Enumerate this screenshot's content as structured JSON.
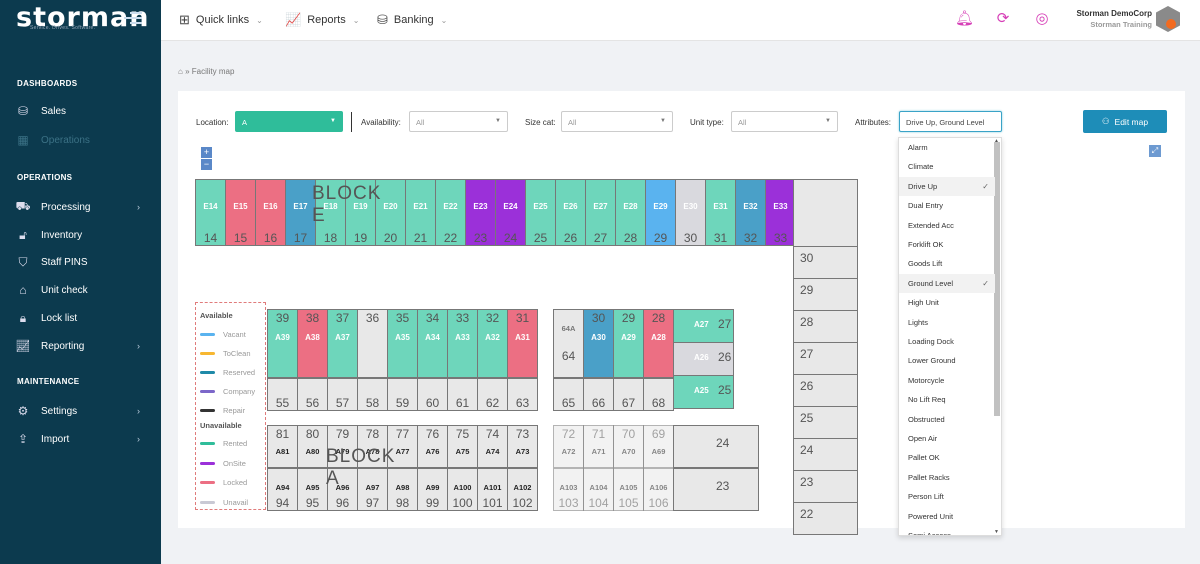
{
  "brand": {
    "name": "storman",
    "tagline": "Service. Drives. Software."
  },
  "sidebar": {
    "sections": [
      {
        "title": "DASHBOARDS",
        "items": [
          {
            "label": "Sales",
            "icon": "piggy-bank-icon"
          },
          {
            "label": "Operations",
            "icon": "building-icon",
            "dim": true
          }
        ]
      },
      {
        "title": "OPERATIONS",
        "items": [
          {
            "label": "Processing",
            "icon": "truck-icon",
            "arrow": true
          },
          {
            "label": "Inventory",
            "icon": "lock-open-icon"
          },
          {
            "label": "Staff PINS",
            "icon": "shield-icon"
          },
          {
            "label": "Unit check",
            "icon": "garage-icon"
          },
          {
            "label": "Lock list",
            "icon": "lock-icon"
          },
          {
            "label": "Reporting",
            "icon": "chart-icon",
            "arrow": true
          }
        ]
      },
      {
        "title": "MAINTENANCE",
        "items": [
          {
            "label": "Settings",
            "icon": "gear-icon",
            "arrow": true
          },
          {
            "label": "Import",
            "icon": "import-icon",
            "arrow": true
          }
        ]
      }
    ]
  },
  "topbar": {
    "menus": [
      {
        "label": "Quick links",
        "icon": "plus-box-icon"
      },
      {
        "label": "Reports",
        "icon": "chart-icon"
      },
      {
        "label": "Banking",
        "icon": "piggy-bank-icon"
      }
    ],
    "user": {
      "company": "Storman DemoCorp",
      "site": "Storman Training"
    }
  },
  "breadcrumb": "» Facility map",
  "filters": {
    "location_label": "Location:",
    "location_value": "A",
    "availability_label": "Availability:",
    "availability_value": "All",
    "size_label": "Size cat:",
    "size_value": "All",
    "unit_type_label": "Unit type:",
    "unit_type_value": "All",
    "attributes_label": "Attributes:",
    "attributes_value": "Drive Up, Ground Level",
    "edit_map": "Edit map"
  },
  "colors": {
    "rented": "#6ed6bb",
    "onsite": "#9b30d9",
    "locked": "#ec6f83",
    "reserved": "#4aa0c8",
    "vacant": "#5ab3ef",
    "unavail": "#d9d9de",
    "empty": "#e8e8e8"
  },
  "legend": {
    "available_title": "Available",
    "unavailable_title": "Unavailable",
    "items": [
      {
        "label": "Vacant",
        "color": "#5ab3ef"
      },
      {
        "label": "ToClean",
        "color": "#f7b731"
      },
      {
        "label": "Reserved",
        "color": "#1f8aa8"
      },
      {
        "label": "Company",
        "color": "#7c67c9"
      },
      {
        "label": "Repair",
        "color": "#333333"
      }
    ],
    "unitems": [
      {
        "label": "Rented",
        "color": "#2fbd9a"
      },
      {
        "label": "OnSite",
        "color": "#9b30d9"
      },
      {
        "label": "Locked",
        "color": "#ec6f83"
      },
      {
        "label": "Unavail",
        "color": "#c9c9d4"
      }
    ]
  },
  "blocks": {
    "e": "BLOCK E",
    "a": "BLOCK A"
  },
  "block_e_units": [
    {
      "label": "E14",
      "num": "14",
      "status": "rented"
    },
    {
      "label": "E15",
      "num": "15",
      "status": "locked"
    },
    {
      "label": "E16",
      "num": "16",
      "status": "locked"
    },
    {
      "label": "E17",
      "num": "17",
      "status": "reserved"
    },
    {
      "label": "E18",
      "num": "18",
      "status": "rented"
    },
    {
      "label": "E19",
      "num": "19",
      "status": "rented"
    },
    {
      "label": "E20",
      "num": "20",
      "status": "rented"
    },
    {
      "label": "E21",
      "num": "21",
      "status": "rented"
    },
    {
      "label": "E22",
      "num": "22",
      "status": "rented"
    },
    {
      "label": "E23",
      "num": "23",
      "status": "onsite"
    },
    {
      "label": "E24",
      "num": "24",
      "status": "onsite"
    },
    {
      "label": "E25",
      "num": "25",
      "status": "rented"
    },
    {
      "label": "E26",
      "num": "26",
      "status": "rented"
    },
    {
      "label": "E27",
      "num": "27",
      "status": "rented"
    },
    {
      "label": "E28",
      "num": "28",
      "status": "rented"
    },
    {
      "label": "E29",
      "num": "29",
      "status": "vacant"
    },
    {
      "label": "E30",
      "num": "30",
      "status": "unavail"
    },
    {
      "label": "E31",
      "num": "31",
      "status": "rented"
    },
    {
      "label": "E32",
      "num": "32",
      "status": "reserved"
    },
    {
      "label": "E33",
      "num": "33",
      "status": "onsite"
    }
  ],
  "right_column": [
    "30",
    "29",
    "28",
    "27",
    "26",
    "25",
    "24",
    "23",
    "22"
  ],
  "a_top_left": [
    {
      "label": "A39",
      "num": "39",
      "status": "rented"
    },
    {
      "label": "A38",
      "num": "38",
      "status": "locked"
    },
    {
      "label": "A37",
      "num": "37",
      "status": "rented"
    },
    {
      "label": "",
      "num": "36",
      "status": "empty"
    },
    {
      "label": "A35",
      "num": "35",
      "status": "rented"
    },
    {
      "label": "A34",
      "num": "34",
      "status": "rented"
    },
    {
      "label": "A33",
      "num": "33",
      "status": "rented"
    },
    {
      "label": "A32",
      "num": "32",
      "status": "rented"
    },
    {
      "label": "A31",
      "num": "31",
      "status": "locked"
    }
  ],
  "a_top_right": [
    {
      "label": "",
      "num": "64",
      "sub": "64A",
      "status": "empty"
    },
    {
      "label": "A30",
      "num": "30",
      "status": "reserved"
    },
    {
      "label": "A29",
      "num": "29",
      "status": "rented"
    },
    {
      "label": "A28",
      "num": "28",
      "status": "locked"
    }
  ],
  "a_side": [
    {
      "label": "A27",
      "num": "27",
      "status": "rented"
    },
    {
      "label": "A26",
      "num": "26",
      "status": "unavail"
    },
    {
      "label": "A25",
      "num": "25",
      "status": "rented"
    }
  ],
  "a_mid_left": [
    "55",
    "56",
    "57",
    "58",
    "59",
    "60",
    "61",
    "62",
    "63"
  ],
  "a_mid_right": [
    "65",
    "66",
    "67",
    "68"
  ],
  "a_bottom_left_top": [
    {
      "num": "81",
      "label": "A81"
    },
    {
      "num": "80",
      "label": "A80"
    },
    {
      "num": "79",
      "label": "A79"
    },
    {
      "num": "78",
      "label": "A78"
    },
    {
      "num": "77",
      "label": "A77"
    },
    {
      "num": "76",
      "label": "A76"
    },
    {
      "num": "75",
      "label": "A75"
    },
    {
      "num": "74",
      "label": "A74"
    },
    {
      "num": "73",
      "label": "A73"
    }
  ],
  "a_bottom_right_top": [
    {
      "num": "72",
      "label": "A72"
    },
    {
      "num": "71",
      "label": "A71"
    },
    {
      "num": "70",
      "label": "A70"
    },
    {
      "num": "69",
      "label": "A69"
    }
  ],
  "a_bottom_left_bottom": [
    {
      "num": "94",
      "label": "A94"
    },
    {
      "num": "95",
      "label": "A95"
    },
    {
      "num": "96",
      "label": "A96"
    },
    {
      "num": "97",
      "label": "A97"
    },
    {
      "num": "98",
      "label": "A98"
    },
    {
      "num": "99",
      "label": "A99"
    },
    {
      "num": "100",
      "label": "A100"
    },
    {
      "num": "101",
      "label": "A101"
    },
    {
      "num": "102",
      "label": "A102"
    }
  ],
  "a_bottom_right_bottom": [
    {
      "num": "103",
      "label": "A103"
    },
    {
      "num": "104",
      "label": "A104"
    },
    {
      "num": "105",
      "label": "A105"
    },
    {
      "num": "106",
      "label": "A106"
    }
  ],
  "a_right_block": [
    "24",
    "23"
  ],
  "attributes": [
    {
      "label": "Alarm"
    },
    {
      "label": "Climate"
    },
    {
      "label": "Drive Up",
      "checked": true
    },
    {
      "label": "Dual Entry"
    },
    {
      "label": "Extended Acc"
    },
    {
      "label": "Forklift OK"
    },
    {
      "label": "Goods Lift"
    },
    {
      "label": "Ground Level",
      "checked": true
    },
    {
      "label": "High Unit"
    },
    {
      "label": "Lights"
    },
    {
      "label": "Loading Dock"
    },
    {
      "label": "Lower Ground"
    },
    {
      "label": "Motorcycle"
    },
    {
      "label": "No Lift Req"
    },
    {
      "label": "Obstructed"
    },
    {
      "label": "Open Air"
    },
    {
      "label": "Pallet OK"
    },
    {
      "label": "Pallet Racks"
    },
    {
      "label": "Person Lift"
    },
    {
      "label": "Powered Unit"
    },
    {
      "label": "Semi Access"
    }
  ]
}
